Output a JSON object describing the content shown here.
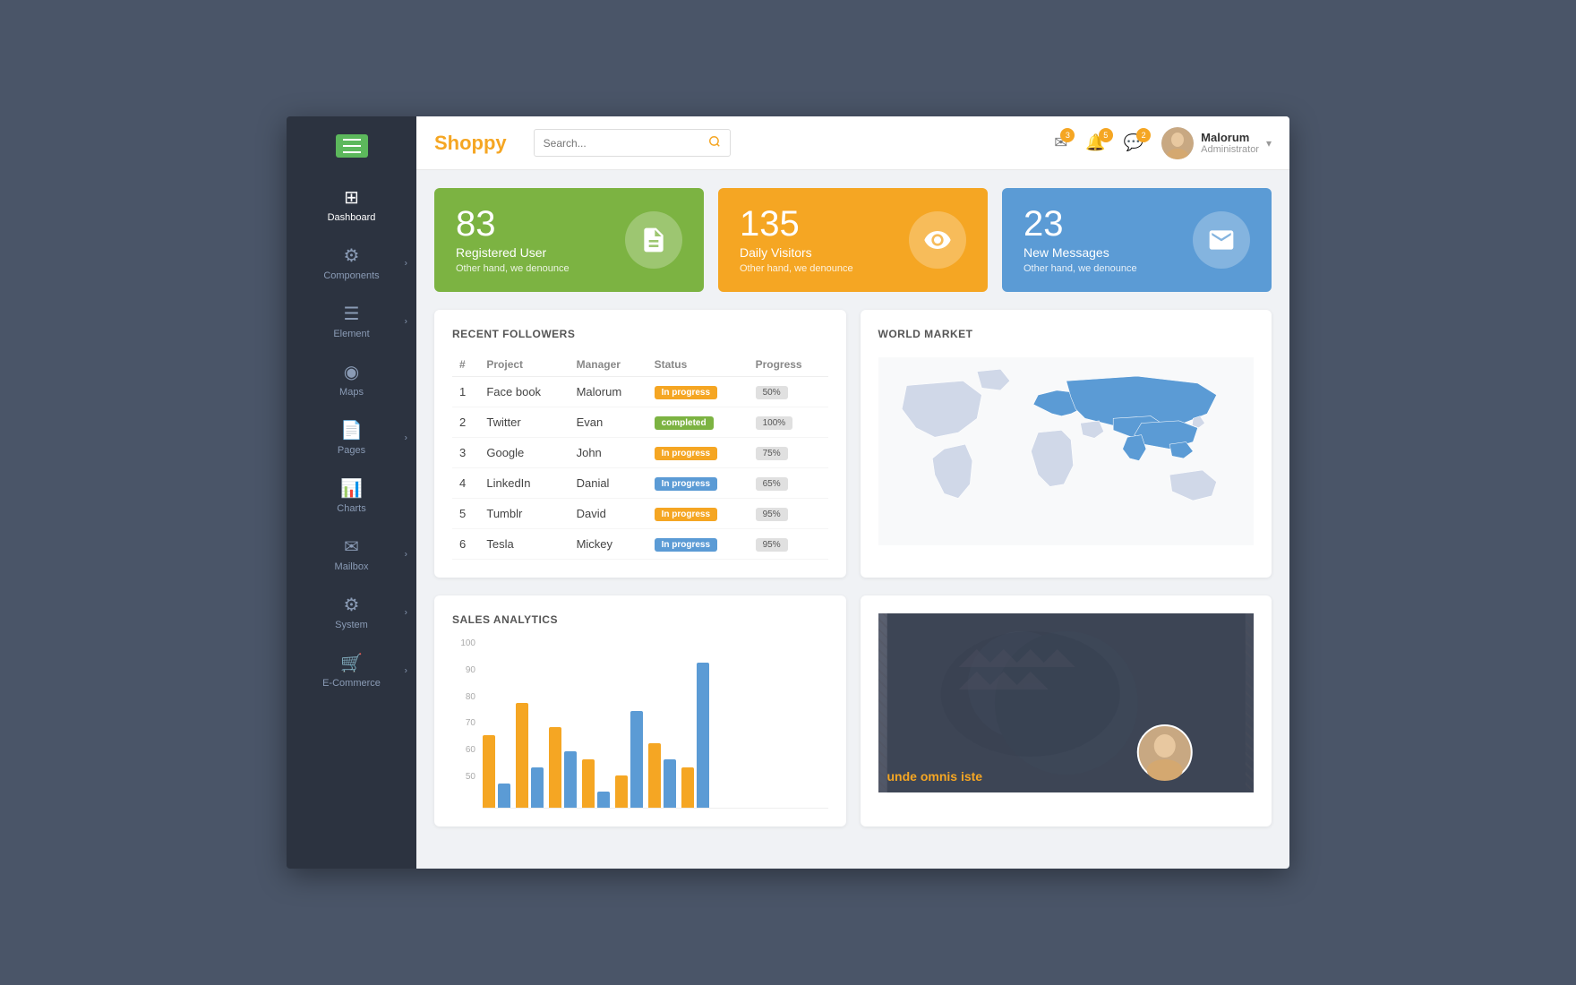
{
  "app": {
    "logo": "Shoppy",
    "search_placeholder": "Search..."
  },
  "header": {
    "notifications_count": "3",
    "alerts_count": "5",
    "messages_count": "2",
    "user_name": "Malorum",
    "user_role": "Administrator"
  },
  "sidebar": {
    "menu_icon_label": "Menu",
    "items": [
      {
        "id": "dashboard",
        "label": "Dashboard",
        "icon": "⊞",
        "has_chevron": false
      },
      {
        "id": "components",
        "label": "Components",
        "icon": "⚙",
        "has_chevron": true
      },
      {
        "id": "element",
        "label": "Element",
        "icon": "☰",
        "has_chevron": true
      },
      {
        "id": "maps",
        "label": "Maps",
        "icon": "◉",
        "has_chevron": false
      },
      {
        "id": "pages",
        "label": "Pages",
        "icon": "📄",
        "has_chevron": true
      },
      {
        "id": "charts",
        "label": "Charts",
        "icon": "📊",
        "has_chevron": false
      },
      {
        "id": "mailbox",
        "label": "Mailbox",
        "icon": "✉",
        "has_chevron": true
      },
      {
        "id": "system",
        "label": "System",
        "icon": "⚙",
        "has_chevron": true
      },
      {
        "id": "ecommerce",
        "label": "E-Commerce",
        "icon": "🛒",
        "has_chevron": true
      }
    ]
  },
  "stats": [
    {
      "number": "83",
      "label": "Registered User",
      "desc": "Other hand, we denounce",
      "icon": "📋",
      "color": "green"
    },
    {
      "number": "135",
      "label": "Daily Visitors",
      "desc": "Other hand, we denounce",
      "icon": "👁",
      "color": "orange"
    },
    {
      "number": "23",
      "label": "New Messages",
      "desc": "Other hand, we denounce",
      "icon": "✉",
      "color": "blue"
    }
  ],
  "followers_table": {
    "title": "RECENT FOLLOWERS",
    "columns": [
      "#",
      "Project",
      "Manager",
      "Status",
      "Progress"
    ],
    "rows": [
      {
        "num": "1",
        "project": "Face book",
        "manager": "Malorum",
        "status": "In progress",
        "status_type": "in-progress",
        "progress": "50%"
      },
      {
        "num": "2",
        "project": "Twitter",
        "manager": "Evan",
        "status": "completed",
        "status_type": "completed",
        "progress": "100%"
      },
      {
        "num": "3",
        "project": "Google",
        "manager": "John",
        "status": "In progress",
        "status_type": "in-progress",
        "progress": "75%"
      },
      {
        "num": "4",
        "project": "LinkedIn",
        "manager": "Danial",
        "status": "In progress",
        "status_type": "in-progress-blue",
        "progress": "65%"
      },
      {
        "num": "5",
        "project": "Tumblr",
        "manager": "David",
        "status": "In progress",
        "status_type": "in-progress",
        "progress": "95%"
      },
      {
        "num": "6",
        "project": "Tesla",
        "manager": "Mickey",
        "status": "In progress",
        "status_type": "in-progress-blue",
        "progress": "95%"
      }
    ]
  },
  "world_market": {
    "title": "WORLD MARKET"
  },
  "sales_analytics": {
    "title": "SALES ANALYTICS",
    "y_axis": [
      "100",
      "90",
      "80",
      "70",
      "60",
      "50"
    ],
    "bars": [
      {
        "orange": 45,
        "blue": 15
      },
      {
        "orange": 65,
        "blue": 25
      },
      {
        "orange": 50,
        "blue": 35
      },
      {
        "orange": 30,
        "blue": 10
      },
      {
        "orange": 20,
        "blue": 60
      },
      {
        "orange": 40,
        "blue": 30
      },
      {
        "orange": 25,
        "blue": 90
      }
    ]
  },
  "profile_card": {
    "quote_text": "unde omnis iste",
    "mini_avatar_label": "Profile"
  }
}
